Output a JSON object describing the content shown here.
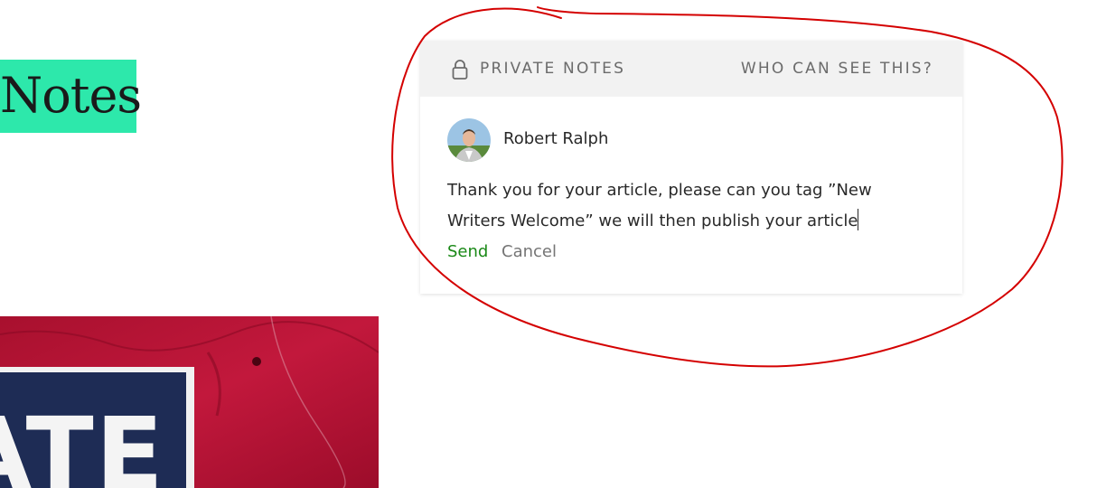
{
  "page": {
    "title_fragment": "Notes",
    "accent_color": "#2de8ab"
  },
  "private_notes": {
    "header_label": "PRIVATE NOTES",
    "visibility_link": "WHO CAN SEE THIS?",
    "author": {
      "name": "Robert Ralph",
      "avatar": "author-photo"
    },
    "note_text": "Thank you for your article, please can you tag ”New Writers Welcome” we will then publish your article",
    "send_label": "Send",
    "cancel_label": "Cancel",
    "send_color": "#1a8917"
  },
  "annotation": {
    "color": "#d40000",
    "shape": "freehand-circle"
  },
  "icons": {
    "lock": "lock-icon"
  }
}
